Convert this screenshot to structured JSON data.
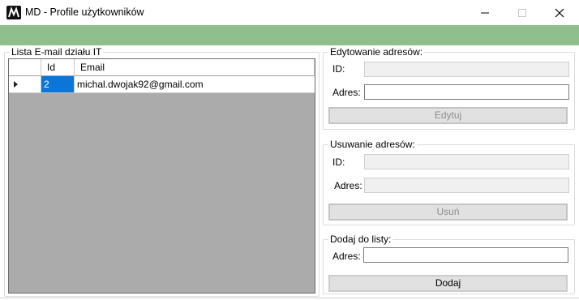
{
  "window": {
    "title": "MD - Profile użytkowników",
    "min_glyph": "—",
    "close_glyph": "✕",
    "accent_color": "#8fbf8c"
  },
  "email_list": {
    "legend": "Lista E-mail działu IT",
    "columns": [
      "Id",
      "Email"
    ],
    "rows": [
      {
        "id": "2",
        "email": "michal.dwojak92@gmail.com"
      }
    ]
  },
  "edit": {
    "legend": "Edytowanie adresów:",
    "id_label": "ID:",
    "id_value": "",
    "address_label": "Adres:",
    "address_value": "",
    "button_label": "Edytuj"
  },
  "delete": {
    "legend": "Usuwanie adresów:",
    "id_label": "ID:",
    "id_value": "",
    "address_label": "Adres:",
    "address_value": "",
    "button_label": "Usuń"
  },
  "add": {
    "legend": "Dodaj do listy:",
    "address_label": "Adres:",
    "address_value": "",
    "button_label": "Dodaj"
  }
}
